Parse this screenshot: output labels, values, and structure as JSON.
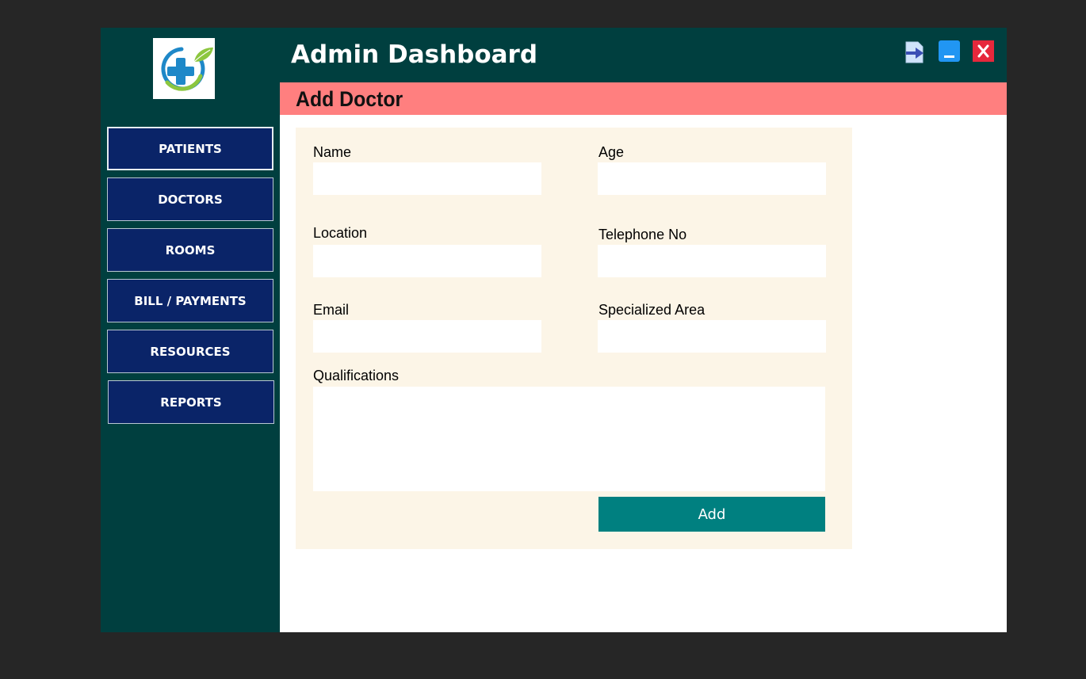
{
  "header": {
    "title": "Admin Dashboard",
    "buttons": [
      {
        "name": "logout",
        "icon": "logout-arrow-icon"
      },
      {
        "name": "minimize",
        "icon": "minimize-icon"
      },
      {
        "name": "close",
        "icon": "close-icon"
      }
    ]
  },
  "sidebar": {
    "logo_icon": "medical-cross-leaf-logo",
    "items": [
      {
        "label": "PATIENTS",
        "active": true
      },
      {
        "label": "DOCTORS",
        "active": false
      },
      {
        "label": "ROOMS",
        "active": false
      },
      {
        "label": "BILL / PAYMENTS",
        "active": false
      },
      {
        "label": "RESOURCES",
        "active": false
      },
      {
        "label": "REPORTS",
        "active": false
      }
    ]
  },
  "section": {
    "title": "Add Doctor"
  },
  "form": {
    "name": {
      "label": "Name",
      "value": ""
    },
    "age": {
      "label": "Age",
      "value": ""
    },
    "location": {
      "label": "Location",
      "value": ""
    },
    "telephone": {
      "label": "Telephone No",
      "value": ""
    },
    "email": {
      "label": "Email",
      "value": ""
    },
    "specialized_area": {
      "label": "Specialized Area",
      "value": ""
    },
    "qualifications": {
      "label": "Qualifications",
      "value": ""
    },
    "submit_label": "Add"
  },
  "colors": {
    "sidebar_bg": "#003f3f",
    "nav_button_bg": "#0a2468",
    "section_bar_bg": "#ff7f7f",
    "form_panel_bg": "#fcf5e7",
    "add_button_bg": "#008080",
    "close_button_bg": "#e6283c",
    "minimize_button_bg": "#2196f3"
  }
}
